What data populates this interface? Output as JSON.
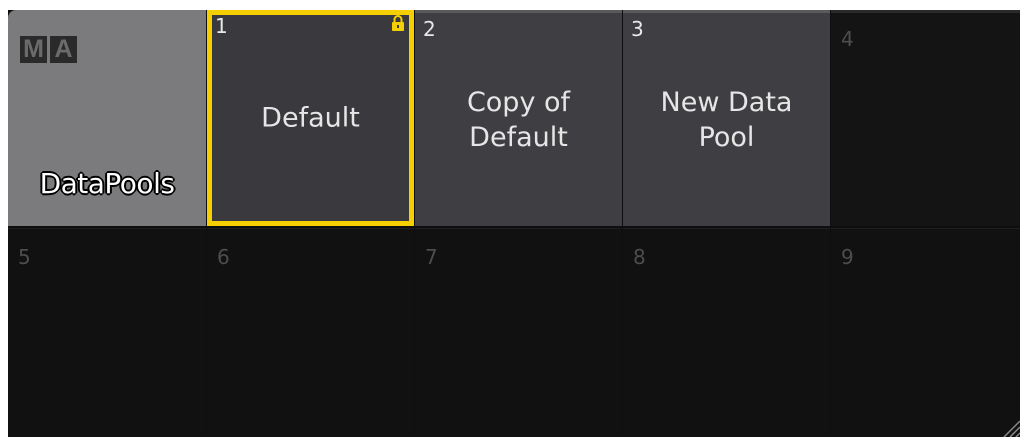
{
  "window": {
    "logo_left": "M",
    "logo_right": "A",
    "title": "DataPools"
  },
  "pools": [
    {
      "number": "1",
      "name": "Default",
      "selected": true,
      "locked": true
    },
    {
      "number": "2",
      "name": "Copy of Default",
      "selected": false,
      "locked": false
    },
    {
      "number": "3",
      "name": "New Data Pool",
      "selected": false,
      "locked": false
    }
  ],
  "empty_slots": [
    "4",
    "5",
    "6",
    "7",
    "8",
    "9"
  ],
  "colors": {
    "selection": "#f5cf00",
    "title_tile": "#7b7b7d",
    "pool_tile": "#3f3f43",
    "empty_tile": "#111111"
  },
  "icons": {
    "lock": "lock-icon",
    "resize": "resize-grip-icon"
  }
}
